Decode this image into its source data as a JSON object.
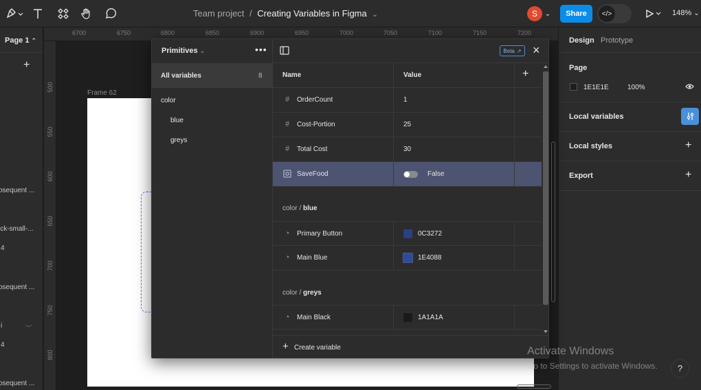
{
  "toolbar": {
    "breadcrumb_project": "Team project",
    "breadcrumb_sep": "/",
    "breadcrumb_file": "Creating Variables in Figma",
    "avatar_initial": "S",
    "share_label": "Share",
    "zoom": "148%",
    "icons": [
      "pen-tool-icon",
      "text-tool-icon",
      "components-icon",
      "hand-tool-icon",
      "comment-icon",
      "play-icon",
      "code-icon"
    ]
  },
  "left_panel": {
    "page_label": "Page 1",
    "layers": [
      "osequent ...",
      "ick-small-...",
      "4",
      "osequent ...",
      "i",
      "4",
      "osequent ..."
    ]
  },
  "ruler": {
    "x_ticks": [
      "6700",
      "6750",
      "6800",
      "6850",
      "6900",
      "6950",
      "7000",
      "7050",
      "7100",
      "7150",
      "7200"
    ],
    "y_ticks": [
      "500",
      "550",
      "600",
      "650",
      "700",
      "750",
      "800"
    ]
  },
  "canvas": {
    "frame_label": "Frame 62"
  },
  "modal": {
    "collection_label": "Primitives",
    "all_variables_label": "All variables",
    "all_variables_count": "8",
    "groups": [
      {
        "label": "color"
      },
      {
        "label": "blue"
      },
      {
        "label": "greys"
      }
    ],
    "beta_label": "Beta",
    "columns": {
      "name": "Name",
      "value": "Value"
    },
    "rows": [
      {
        "name": "OrderCount",
        "value": "1",
        "kind": "number"
      },
      {
        "name": "Cost-Portion",
        "value": "25",
        "kind": "number"
      },
      {
        "name": "Total Cost",
        "value": "30",
        "kind": "number"
      },
      {
        "name": "SaveFood",
        "value": "False",
        "kind": "boolean"
      }
    ],
    "group_blue": {
      "prefix": "color / ",
      "name": "blue"
    },
    "blue_rows": [
      {
        "name": "Primary Button",
        "value": "0C3272",
        "color": "#2a3f86"
      },
      {
        "name": "Main Blue",
        "value": "1E4088",
        "color": "#2b4aa0"
      }
    ],
    "group_greys": {
      "prefix": "color / ",
      "name": "greys"
    },
    "grey_rows": [
      {
        "name": "Main Black",
        "value": "1A1A1A",
        "color": "#1a1a1a"
      }
    ],
    "create_label": "Create variable"
  },
  "right_panel": {
    "tab_design": "Design",
    "tab_prototype": "Prototype",
    "page_section": "Page",
    "page_color": "1E1E1E",
    "page_opacity": "100%",
    "local_variables": "Local variables",
    "local_styles": "Local styles",
    "export": "Export"
  },
  "watermark": {
    "line1": "Activate Windows",
    "line2": "Go to Settings to activate Windows."
  },
  "help_label": "?"
}
